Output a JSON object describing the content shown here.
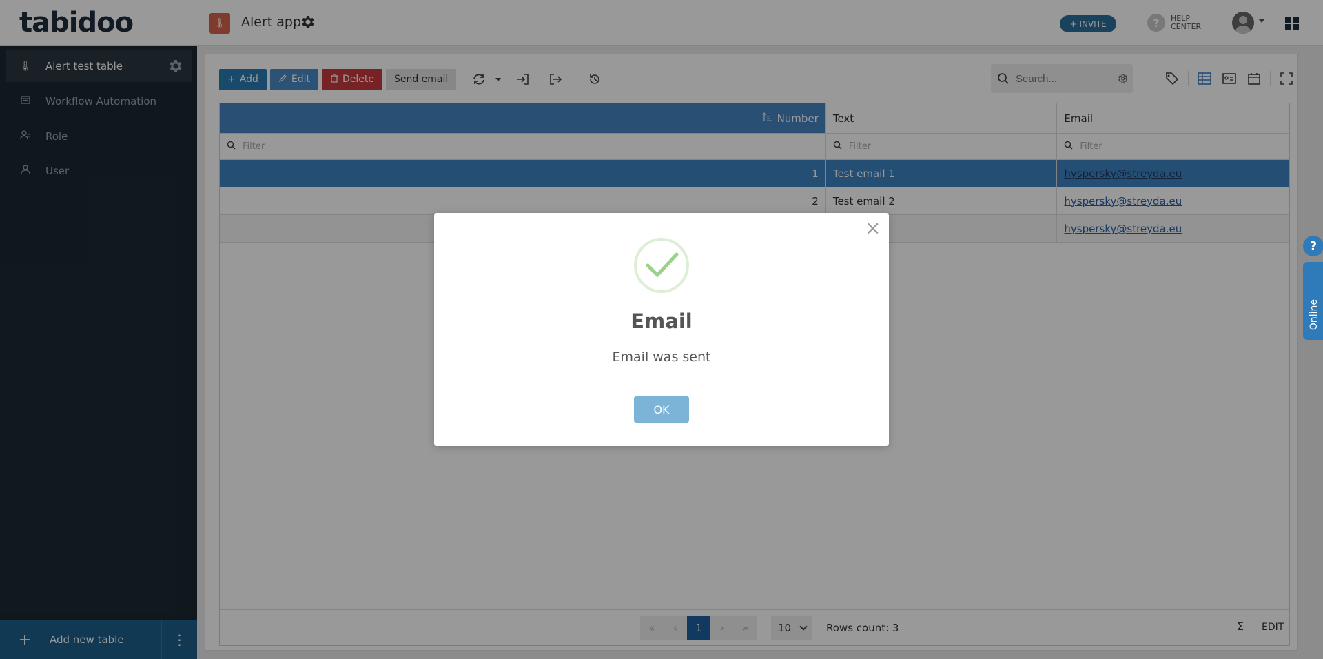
{
  "header": {
    "logo_text": "tabidoo",
    "app_title": "Alert app",
    "invite_label": "INVITE",
    "help_line1": "HELP",
    "help_line2": "CENTER"
  },
  "sidebar": {
    "items": [
      {
        "label": "Alert test table",
        "icon": "thermometer-icon",
        "active": true
      },
      {
        "label": "Workflow Automation",
        "icon": "workflow-icon"
      },
      {
        "label": "Role",
        "icon": "role-icon"
      },
      {
        "label": "User",
        "icon": "user-icon"
      }
    ],
    "add_table_label": "Add new table"
  },
  "toolbar": {
    "add_label": "Add",
    "edit_label": "Edit",
    "delete_label": "Delete",
    "send_email_label": "Send email",
    "search_placeholder": "Search..."
  },
  "table": {
    "columns": [
      "Number",
      "Text",
      "Email"
    ],
    "filter_placeholder": "Filter",
    "rows": [
      {
        "number": "1",
        "text": "Test email 1",
        "email": "hyspersky@streyda.eu",
        "selected": true
      },
      {
        "number": "2",
        "text": "Test email 2",
        "email": "hyspersky@streyda.eu"
      },
      {
        "number": "",
        "text": "",
        "email": "hyspersky@streyda.eu"
      }
    ],
    "pager": {
      "current_page": "1",
      "page_size": "10",
      "rows_count": "Rows count: 3"
    },
    "footer_sigma": "Σ",
    "footer_edit": "EDIT"
  },
  "modal": {
    "title": "Email",
    "message": "Email was sent",
    "ok_label": "OK"
  },
  "widgets": {
    "help_float": "?",
    "online_label": "Online"
  },
  "colors": {
    "sidebar_bg": "#1c2833",
    "primary": "#2a7ab3",
    "selected_row": "#3e83c4",
    "delete": "#c6393d",
    "app_icon": "#d4654d"
  }
}
